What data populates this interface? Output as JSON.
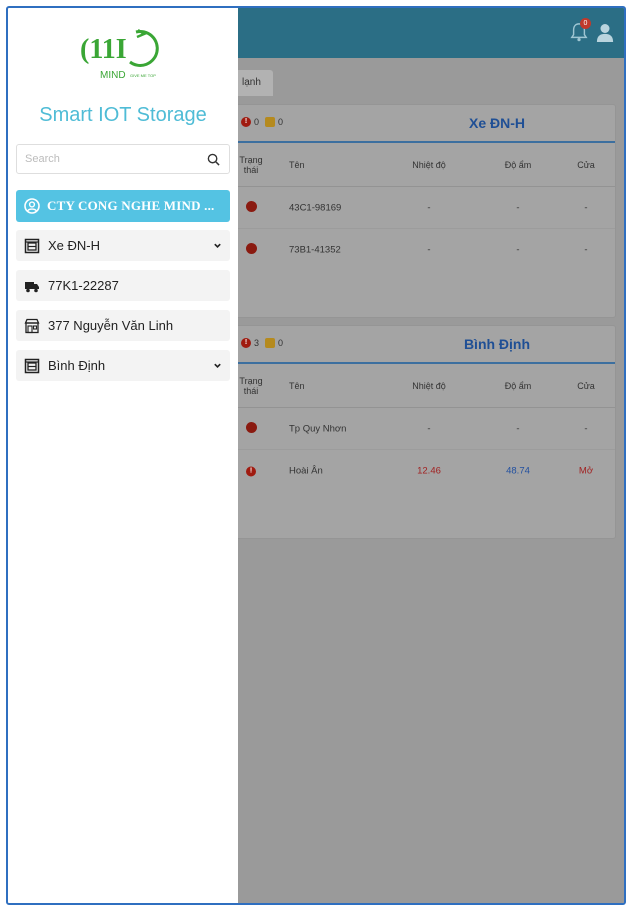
{
  "topbar": {
    "notification_count": "0"
  },
  "tabs": [
    {
      "label": "lạnh"
    }
  ],
  "table_headers": {
    "status": "Trạng thái",
    "name": "Tên",
    "temperature": "Nhiệt độ",
    "humidity": "Độ ẩm",
    "door": "Cửa"
  },
  "groups": [
    {
      "title": "Xe ĐN-H",
      "error_count": "0",
      "warning_count": "0",
      "rows": [
        {
          "name": "43C1-98169",
          "temperature": "-",
          "humidity": "-",
          "door": "-"
        },
        {
          "name": "73B1-41352",
          "temperature": "-",
          "humidity": "-",
          "door": "-"
        }
      ]
    },
    {
      "title": "Bình Định",
      "error_count": "3",
      "warning_count": "0",
      "rows": [
        {
          "name": "Tp Quy Nhơn",
          "temperature": "-",
          "humidity": "-",
          "door": "-"
        },
        {
          "name": "Hoài Ân",
          "temperature": "12.46",
          "humidity": "48.74",
          "door": "Mở"
        }
      ]
    }
  ],
  "drawer": {
    "logo": {
      "text": "MIND",
      "tagline": "GIVE ME TOP"
    },
    "app_title": "Smart IOT Storage",
    "search_placeholder": "Search",
    "org_label": "CTY CONG NGHE MIND ...",
    "items": [
      {
        "label": "Xe ĐN-H",
        "icon": "warehouse-icon",
        "expandable": true
      },
      {
        "label": "77K1-22287",
        "icon": "truck-icon",
        "expandable": false
      },
      {
        "label": "377 Nguyễn Văn Linh",
        "icon": "store-icon",
        "expandable": false
      },
      {
        "label": "Bình Định",
        "icon": "warehouse-icon",
        "expandable": true
      }
    ]
  },
  "colors": {
    "accent": "#54c3e3",
    "title": "#4fbcd6",
    "topbar": "#2b6e85",
    "frame": "#2f6fc0"
  }
}
